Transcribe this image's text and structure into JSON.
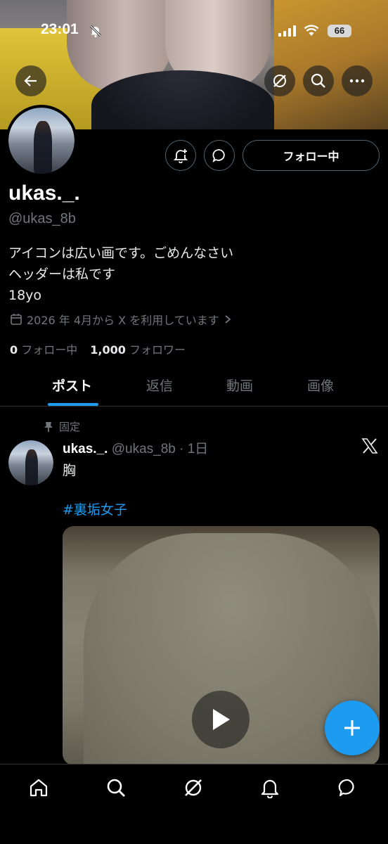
{
  "status_bar": {
    "time": "23:01",
    "battery": "66"
  },
  "profile": {
    "name": "ukas._.",
    "handle": "@ukas_8b",
    "bio_lines": [
      "アイコンは広い画です。ごめんなさい",
      "ヘッダーは私です",
      "18yo"
    ],
    "joined": "2026 年 4月から X を利用しています",
    "following_count": "0",
    "following_label": "フォロー中",
    "followers_count": "1,000",
    "followers_label": "フォロワー",
    "follow_button": "フォロー中"
  },
  "tabs": [
    "ポスト",
    "返信",
    "動画",
    "画像"
  ],
  "active_tab": "ポスト",
  "post": {
    "pinned_label": "固定",
    "author_name": "ukas._.",
    "meta": "@ukas_8b · 1日",
    "text": "胸",
    "hashtag": "#裏垢女子"
  },
  "icons": {
    "top": [
      "back-arrow-icon",
      "grok-icon",
      "search-icon",
      "more-icon"
    ],
    "profile_actions": [
      "notification-bell-icon",
      "message-icon"
    ],
    "bottom_nav": [
      "home-icon",
      "search-icon",
      "grok-icon",
      "notifications-icon",
      "messages-icon"
    ]
  },
  "colors": {
    "accent": "#1d9bf0",
    "muted": "#71767b",
    "background": "#000000"
  }
}
